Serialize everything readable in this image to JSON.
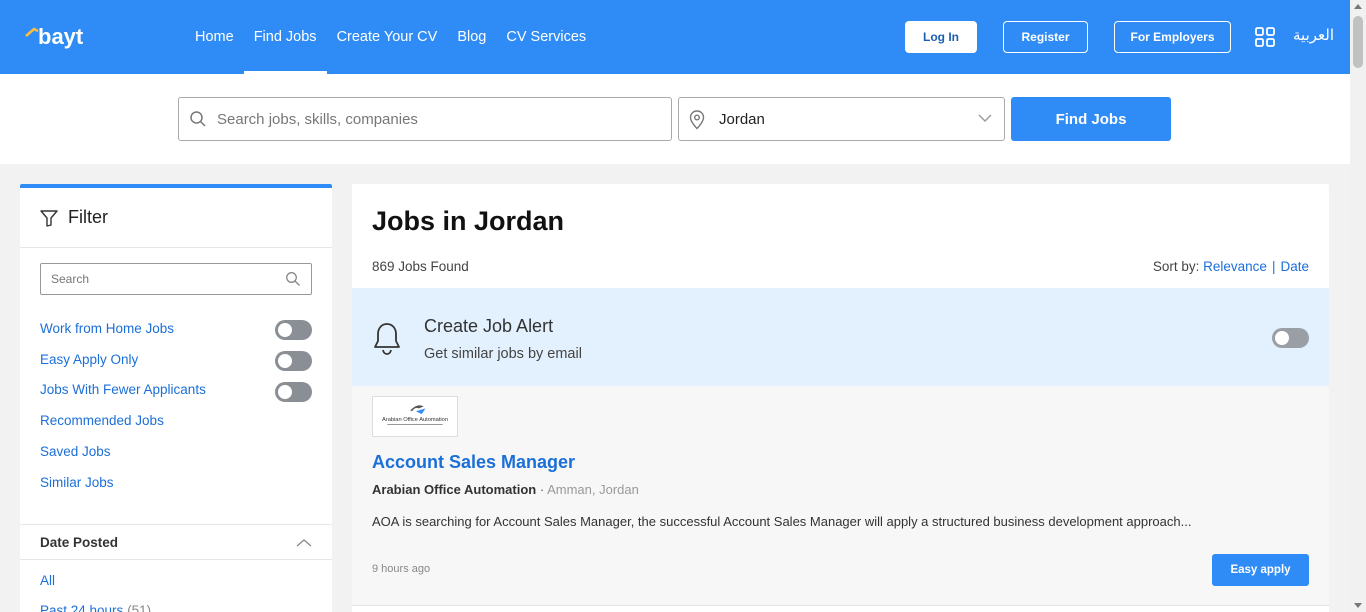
{
  "header": {
    "logo_text": "bayt",
    "nav": [
      {
        "label": "Home"
      },
      {
        "label": "Find Jobs",
        "active": true
      },
      {
        "label": "Create Your CV"
      },
      {
        "label": "Blog"
      },
      {
        "label": "CV Services"
      }
    ],
    "login_label": "Log In",
    "register_label": "Register",
    "employers_label": "For Employers",
    "apps_icon": "grid-apps-icon",
    "language_label": "العربية"
  },
  "search": {
    "keyword_placeholder": "Search jobs, skills, companies",
    "location_value": "Jordan",
    "find_button": "Find Jobs"
  },
  "filter": {
    "title": "Filter",
    "search_placeholder": "Search",
    "toggles": [
      {
        "label": "Work from Home Jobs",
        "on": false
      },
      {
        "label": "Easy Apply Only",
        "on": false
      },
      {
        "label": "Jobs With Fewer Applicants",
        "on": false
      }
    ],
    "links": [
      "Recommended Jobs",
      "Saved Jobs",
      "Similar Jobs"
    ],
    "date_posted": {
      "label": "Date Posted",
      "options": [
        {
          "label": "All",
          "count": ""
        },
        {
          "label": "Past 24 hours",
          "count": "(51)"
        }
      ]
    }
  },
  "results": {
    "heading": "Jobs in Jordan",
    "count_text": "869 Jobs Found",
    "sort_label": "Sort by:",
    "sort_options": [
      "Relevance",
      "Date"
    ],
    "alert": {
      "title": "Create Job Alert",
      "subtitle": "Get similar jobs by email",
      "on": false
    },
    "jobs": [
      {
        "logo_caption": "Arabian Office Automation",
        "title": "Account Sales Manager",
        "company": "Arabian Office Automation",
        "separator": "·",
        "location": "Amman, Jordan",
        "description": "AOA is searching for Account Sales Manager, the successful Account Sales Manager will apply a structured business development approach...",
        "posted": "9 hours ago",
        "apply_label": "Easy apply"
      }
    ]
  },
  "colors": {
    "brand": "#2f8cf6",
    "link": "#1b6fd8",
    "alert_bg": "#e3f0fd"
  }
}
